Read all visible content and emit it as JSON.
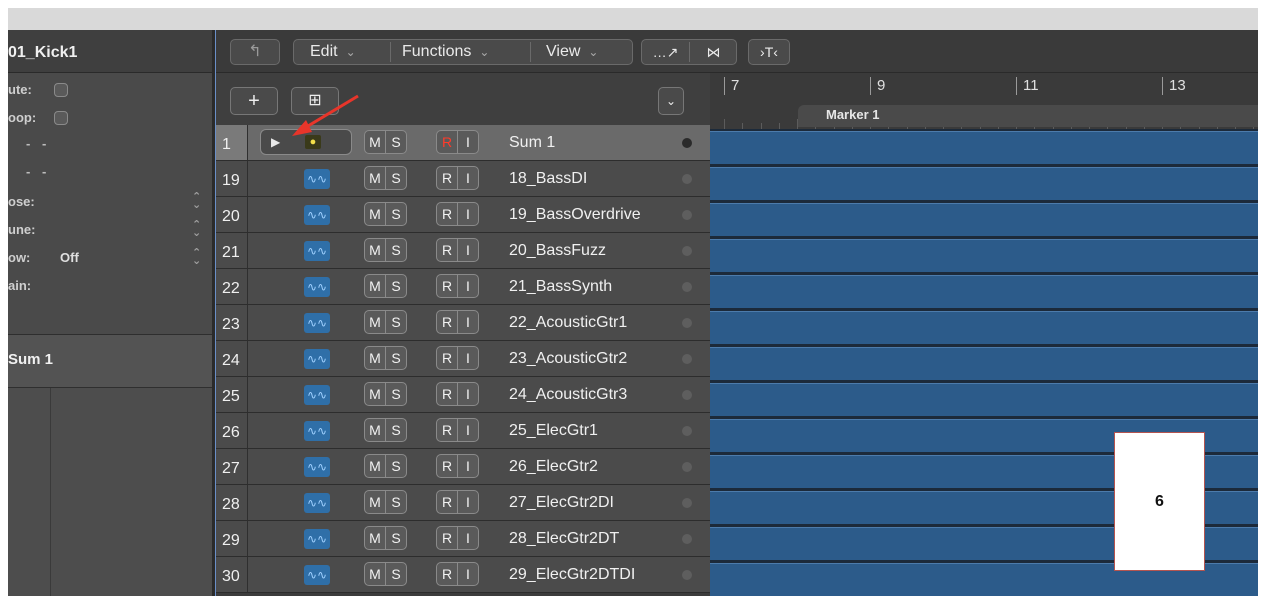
{
  "inspector": {
    "region_name": "01_Kick1",
    "rows": [
      {
        "label": "ute:",
        "kind": "checkbox"
      },
      {
        "label": "oop:",
        "kind": "checkbox"
      },
      {
        "label": "",
        "kind": "dashes",
        "value": "- -"
      },
      {
        "label": "",
        "kind": "dashes",
        "value": "- -"
      },
      {
        "label": "ose:",
        "kind": "stepper"
      },
      {
        "label": "une:",
        "kind": "stepper"
      },
      {
        "label": "ow:",
        "kind": "stepper",
        "value": "Off"
      },
      {
        "label": "ain:",
        "kind": "plain"
      }
    ],
    "track_name": "Sum 1"
  },
  "toolbar": {
    "menus": [
      "Edit",
      "Functions",
      "View"
    ]
  },
  "ruler": {
    "bars": [
      "7",
      "9",
      "11",
      "13"
    ],
    "marker": "Marker 1"
  },
  "tracks": [
    {
      "number": "1",
      "name": "Sum 1",
      "type": "summing-stack",
      "selected": true,
      "record_armed": true
    },
    {
      "number": "19",
      "name": "18_BassDI",
      "type": "audio"
    },
    {
      "number": "20",
      "name": "19_BassOverdrive",
      "type": "audio"
    },
    {
      "number": "21",
      "name": "20_BassFuzz",
      "type": "audio"
    },
    {
      "number": "22",
      "name": "21_BassSynth",
      "type": "audio"
    },
    {
      "number": "23",
      "name": "22_AcousticGtr1",
      "type": "audio"
    },
    {
      "number": "24",
      "name": "23_AcousticGtr2",
      "type": "audio"
    },
    {
      "number": "25",
      "name": "24_AcousticGtr3",
      "type": "audio"
    },
    {
      "number": "26",
      "name": "25_ElecGtr1",
      "type": "audio"
    },
    {
      "number": "27",
      "name": "26_ElecGtr2",
      "type": "audio"
    },
    {
      "number": "28",
      "name": "27_ElecGtr2DI",
      "type": "audio"
    },
    {
      "number": "29",
      "name": "28_ElecGtr2DT",
      "type": "audio"
    },
    {
      "number": "30",
      "name": "29_ElecGtr2DTDI",
      "type": "audio"
    }
  ],
  "track_buttons": {
    "mute": "M",
    "solo": "S",
    "record": "R",
    "input": "I"
  },
  "overlay_label": "6",
  "colors": {
    "region_blue": "#2c5b8a",
    "record_red": "#ff3a2a",
    "annotation_red": "#e8352a"
  }
}
